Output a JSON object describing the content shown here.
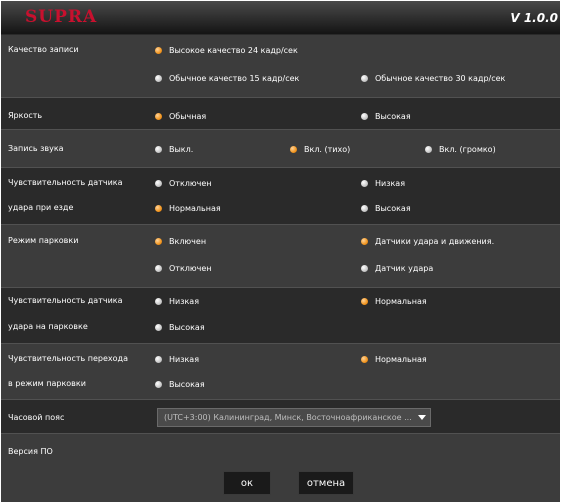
{
  "header": {
    "logo": "SUPRA",
    "version": "V 1.0.0"
  },
  "settings": {
    "record_quality": {
      "label": "Качество записи",
      "options": [
        "Высокое качество 24 кадр/сек",
        "Обычное качество 15 кадр/сек",
        "Обычное качество 30 кадр/сек"
      ],
      "selected": 0
    },
    "brightness": {
      "label": "Яркость",
      "options": [
        "Обычная",
        "Высокая"
      ],
      "selected": 0
    },
    "sound": {
      "label": "Запись звука",
      "options": [
        "Выкл.",
        "Вкл. (тихо)",
        "Вкл. (громко)"
      ],
      "selected": 1
    },
    "driving_shock": {
      "label_line1": "Чувствительность датчика",
      "label_line2": "удара при езде",
      "options": [
        "Отключен",
        "Низкая",
        "Нормальная",
        "Высокая"
      ],
      "selected": 2
    },
    "parking_mode": {
      "label": "Режим парковки",
      "options": [
        "Включен",
        "Датчики удара и движения.",
        "Отключен",
        "Датчик удара"
      ],
      "selected": [
        0,
        1
      ]
    },
    "parking_shock": {
      "label_line1": "Чувствительность датчика",
      "label_line2": "удара на парковке",
      "options": [
        "Низкая",
        "Нормальная",
        "Высокая"
      ],
      "selected": 1
    },
    "parking_transition": {
      "label_line1": "Чувствительность перехода",
      "label_line2": "в режим парковки",
      "options": [
        "Низкая",
        "Нормальная",
        "Высокая"
      ],
      "selected": 1
    },
    "timezone": {
      "label": "Часовой пояс",
      "value": "(UTC+3:00) Калининград, Минск, Восточноафриканское ..."
    },
    "firmware": {
      "label": "Версия ПО"
    }
  },
  "buttons": {
    "ok": "ок",
    "cancel": "отмена"
  },
  "colors": {
    "accent": "#f2961f",
    "brand": "#c8102e",
    "background": "#2a2a2a"
  }
}
